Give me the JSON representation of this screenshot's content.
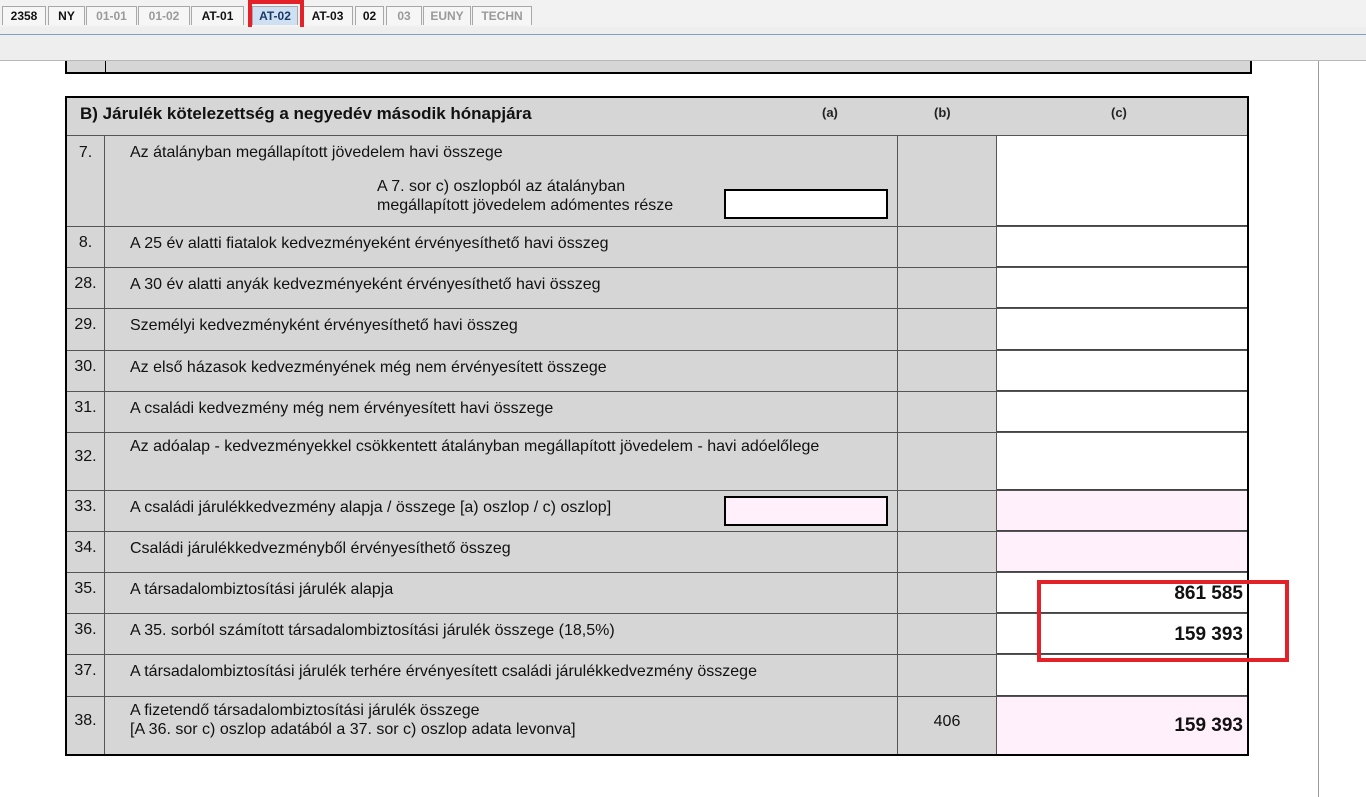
{
  "tabs": [
    {
      "label": "2358",
      "state": "normal"
    },
    {
      "label": "NY",
      "state": "normal"
    },
    {
      "label": "01-01",
      "state": "disabled"
    },
    {
      "label": "01-02",
      "state": "disabled"
    },
    {
      "label": "AT-01",
      "state": "normal"
    },
    {
      "label": "AT-02",
      "state": "active"
    },
    {
      "label": "AT-03",
      "state": "normal"
    },
    {
      "label": "02",
      "state": "normal"
    },
    {
      "label": "03",
      "state": "disabled"
    },
    {
      "label": "EUNY",
      "state": "disabled"
    },
    {
      "label": "TECHN",
      "state": "disabled"
    }
  ],
  "section": {
    "title": "B) Járulék kötelezettség a negyedév második hónapjára",
    "col_a": "(a)",
    "col_b": "(b)",
    "col_c": "(c)"
  },
  "rows": [
    {
      "num": "7.",
      "desc": "Az átalányban megállapított jövedelem havi összege",
      "sub_desc": "A 7. sor c) oszlopból az átalányban megállapított jövedelem adómentes része",
      "b": "",
      "c": ""
    },
    {
      "num": "8.",
      "desc": "A 25 év alatti fiatalok kedvezményeként érvényesíthető havi összeg",
      "b": "",
      "c": ""
    },
    {
      "num": "28.",
      "desc": "A 30 év alatti anyák kedvezményeként érvényesíthető havi összeg",
      "b": "",
      "c": ""
    },
    {
      "num": "29.",
      "desc": "Személyi kedvezményként érvényesíthető havi összeg",
      "b": "",
      "c": ""
    },
    {
      "num": "30.",
      "desc": "Az első házasok kedvezményének még nem érvényesített összege",
      "b": "",
      "c": ""
    },
    {
      "num": "31.",
      "desc": "A családi kedvezmény még nem érvényesített havi összege",
      "b": "",
      "c": ""
    },
    {
      "num": "32.",
      "desc": "Az adóalap - kedvezményekkel csökkentett átalányban megállapított jövedelem - havi adóelőlege",
      "b": "",
      "c": ""
    },
    {
      "num": "33.",
      "desc": "A családi járulékkedvezmény alapja / összege [a) oszlop / c) oszlop]",
      "b": "",
      "c": ""
    },
    {
      "num": "34.",
      "desc": "Családi járulékkedvezményből érvényesíthető összeg",
      "b": "",
      "c": ""
    },
    {
      "num": "35.",
      "desc": "A társadalombiztosítási járulék alapja",
      "b": "",
      "c": "861 585"
    },
    {
      "num": "36.",
      "desc": "A 35. sorból számított társadalombiztosítási járulék összege (18,5%)",
      "b": "",
      "c": "159 393"
    },
    {
      "num": "37.",
      "desc": "A társadalombiztosítási járulék terhére érvényesített családi járulékkedvezmény összege",
      "b": "",
      "c": ""
    },
    {
      "num": "38.",
      "desc": "A fizetendő társadalombiztosítási járulék összege",
      "desc_line2": "[A 36. sor c) oszlop adatából a 37. sor c) oszlop adata levonva]",
      "b": "406",
      "c": "159 393"
    }
  ],
  "colors": {
    "highlight": "#e32129",
    "pink_field": "#fff0fb",
    "gray_cell": "#d6d6d6"
  }
}
